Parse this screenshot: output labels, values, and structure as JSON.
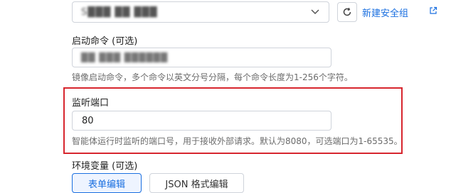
{
  "security_group": {
    "selected_value": "S███ ██ ███",
    "new_link_label": "新建安全组"
  },
  "startup_command": {
    "label": "启动命令 (可选)",
    "value": "██ ███ ██████",
    "help": "镜像启动命令，多个命令以英文分号分隔，每个命令长度为1-256个字符。"
  },
  "listen_port": {
    "label": "监听端口",
    "value": "80",
    "help": "智能体运行时监听的端口号，用于接收外部请求。默认为8080，可选端口为1-65535。"
  },
  "env_vars": {
    "label": "环境变量 (可选)",
    "tabs": [
      {
        "label": "表单编辑",
        "active": true
      },
      {
        "label": "JSON 格式编辑",
        "active": false
      }
    ]
  },
  "colors": {
    "accent": "#1a6fe0",
    "highlight": "#d7262e"
  },
  "icons": [
    "chevron-down-icon",
    "refresh-icon",
    "external-link-icon"
  ]
}
